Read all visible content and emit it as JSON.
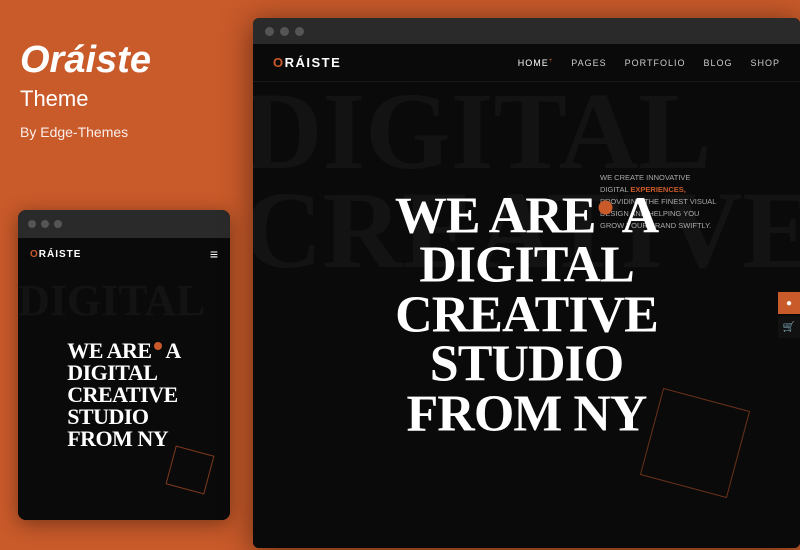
{
  "sidebar": {
    "title": "Oráiste",
    "subtitle": "Theme",
    "author": "By Edge-Themes"
  },
  "mobile_preview": {
    "browser_dots": [
      "dot1",
      "dot2",
      "dot3"
    ],
    "logo_prefix": "O",
    "logo_text": "RÁISTE",
    "hero_line1": "WE ARE",
    "hero_dot": "•",
    "hero_line2": "A",
    "hero_line3": "DIGITAL",
    "hero_line4": "CREATIVE",
    "hero_line5": "STUDIO",
    "hero_line6": "FROM NY",
    "bg_text": "DIGITAL"
  },
  "desktop_preview": {
    "browser_dots": [
      "dot1",
      "dot2",
      "dot3"
    ],
    "logo_prefix": "O",
    "logo_text": "RÁISTE",
    "nav_links": [
      "HOME",
      "PAGES",
      "PORTFOLIO",
      "BLOG",
      "SHOP"
    ],
    "hero_line1": "WE ARE",
    "hero_dot": "•",
    "hero_line2": "A",
    "hero_line3": "DIGITAL",
    "hero_line4": "CREATIVE",
    "hero_line5": "STUDIO",
    "hero_line6": "FROM NY",
    "sub_text_bold": "EXPERIENCES,",
    "sub_text": "WE CREATE INNOVATIVE DIGITAL EXPERIENCES, PROVIDING THE FINEST VISUAL DESIGN AND HELPING YOU GROW YOUR BRAND SWIFTLY.",
    "bg_text": "DIGITAL"
  },
  "colors": {
    "accent": "#c95a2a",
    "bg_dark": "#0a0a0a",
    "sidebar_bg": "#c95a2a"
  }
}
